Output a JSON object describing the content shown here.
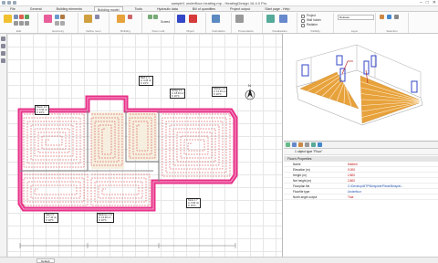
{
  "window": {
    "title": "sample1 underfloor-heating.mp - HeatingDesign 16.4.0 Pro",
    "minimize": "–",
    "maximize": "□",
    "close": "✕"
  },
  "ribbon": {
    "tabs": [
      {
        "label": "File",
        "active": false
      },
      {
        "label": "General",
        "active": false
      },
      {
        "label": "Building elements",
        "active": false
      },
      {
        "label": "Building model",
        "active": true
      },
      {
        "label": "Tools",
        "active": false
      },
      {
        "label": "Hydraulic data",
        "active": false
      },
      {
        "label": "Bill of quantities",
        "active": false
      },
      {
        "label": "Project output",
        "active": false
      },
      {
        "label": "Start page - Help",
        "active": false
      }
    ],
    "groups": [
      {
        "label": "Edit"
      },
      {
        "label": "Geometry"
      },
      {
        "label": "Define room"
      },
      {
        "label": "Building"
      },
      {
        "label": "Room edit"
      },
      {
        "label": "Object"
      },
      {
        "label": "Calculation"
      },
      {
        "label": "Presentation"
      },
      {
        "label": "Visualisation"
      },
      {
        "label": "Visibility"
      },
      {
        "label": "Layer"
      },
      {
        "label": "Selection"
      }
    ],
    "check_options": [
      "Project",
      "Wall holder",
      "Radiator"
    ],
    "layer_dropdown_value": "Release",
    "screed_label": "Screed"
  },
  "plan": {
    "room_labels": [
      {
        "lines": [
          "Room 1.2",
          "A: 6.50 m²",
          "θ: 24°C"
        ]
      },
      {
        "lines": [
          "Bath 1.4",
          "A: 4.25 m²",
          "θ: 24°C"
        ]
      },
      {
        "lines": [
          "Living 1.1",
          "A: 18.20 m²",
          "θ: 20°C"
        ]
      },
      {
        "lines": [
          "Kitchen 1.3",
          "A: 12.40 m²",
          "θ: 20°C"
        ]
      },
      {
        "lines": [
          "Hall 1.5",
          "A: 7.10 m²",
          "θ: 18°C"
        ]
      },
      {
        "lines": [
          "Bedroom 1.6",
          "A: 14.30 m²",
          "θ: 20°C"
        ]
      },
      {
        "lines": [
          "Store 1.7",
          "A: 3.90 m²",
          "θ: 15°C"
        ]
      }
    ],
    "north_label": "N"
  },
  "status": {
    "sheet_tab": "Default"
  },
  "properties": {
    "object_type_label": "1 object type \"Floor\"",
    "section_title": "Floor's Properties",
    "rows": [
      {
        "name": "Name",
        "value": "Kitchen",
        "blue": false
      },
      {
        "name": "Elevation (m)",
        "value": "0.000",
        "blue": false
      },
      {
        "name": "Height (m)",
        "value": "2.800",
        "blue": false
      },
      {
        "name": "Net height (m)",
        "value": "2.800",
        "blue": false
      },
      {
        "name": "Floorplan file",
        "value": "C:\\Develop\\MTP\\Beispiele\\Pläne\\Beispiel...",
        "blue": true
      },
      {
        "name": "Floorfile type",
        "value": "Underfloor",
        "blue": true
      },
      {
        "name": "North angle output",
        "value": "True",
        "blue": false
      }
    ]
  },
  "colors": {
    "wall": "#e8318a",
    "wall_inner": "#f4a6c8",
    "pipe": "#d63a3a",
    "pipe_light": "#f0c9c9",
    "floor_3d": "#e8a23c",
    "radiator_3d": "#3346c8",
    "accent_red": "#b00020"
  }
}
